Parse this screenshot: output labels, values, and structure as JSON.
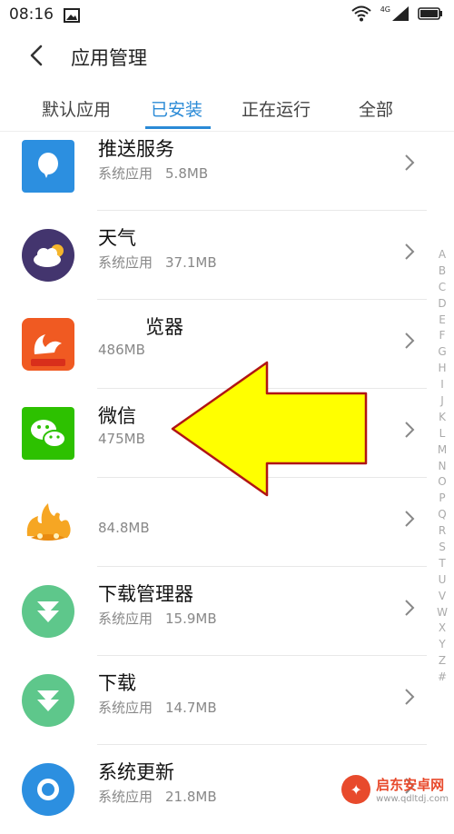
{
  "status_bar": {
    "time": "08:16",
    "network": "4G",
    "icons": [
      "image-notification-icon",
      "wifi-icon",
      "signal-icon",
      "battery-icon"
    ]
  },
  "header": {
    "title": "应用管理",
    "back_icon": "chevron-left-icon"
  },
  "tabs": [
    {
      "label": "默认应用",
      "active": false
    },
    {
      "label": "已安装",
      "active": true
    },
    {
      "label": "正在运行",
      "active": false
    },
    {
      "label": "全部",
      "active": false
    }
  ],
  "apps": [
    {
      "name": "推送服务",
      "type": "系统应用",
      "size": "5.8MB",
      "icon": "push-service-icon"
    },
    {
      "name": "天气",
      "type": "系统应用",
      "size": "37.1MB",
      "icon": "weather-icon"
    },
    {
      "name": "览器",
      "type": "",
      "size": "486MB",
      "icon": "uc-browser-icon"
    },
    {
      "name": "微信",
      "type": "",
      "size": "475MB",
      "icon": "wechat-icon"
    },
    {
      "name": "",
      "type": "",
      "size": "84.8MB",
      "icon": "flame-app-icon"
    },
    {
      "name": "下载管理器",
      "type": "系统应用",
      "size": "15.9MB",
      "icon": "download-manager-icon"
    },
    {
      "name": "下载",
      "type": "系统应用",
      "size": "14.7MB",
      "icon": "download-icon"
    },
    {
      "name": "系统更新",
      "type": "系统应用",
      "size": "21.8MB",
      "icon": "system-update-icon"
    }
  ],
  "alphabet": [
    "A",
    "B",
    "C",
    "D",
    "E",
    "F",
    "G",
    "H",
    "I",
    "J",
    "K",
    "L",
    "M",
    "N",
    "O",
    "P",
    "Q",
    "R",
    "S",
    "T",
    "U",
    "V",
    "W",
    "X",
    "Y",
    "Z",
    "#"
  ],
  "overlay": {
    "annotation": "yellow-arrow-pointing-left",
    "color": "#ffff00"
  },
  "watermark": {
    "name": "启东安卓网",
    "url": "www.qdltdj.com"
  },
  "colors": {
    "accent": "#2a8ad6",
    "arrow_fill": "#ffff00",
    "arrow_stroke": "#b01515"
  }
}
